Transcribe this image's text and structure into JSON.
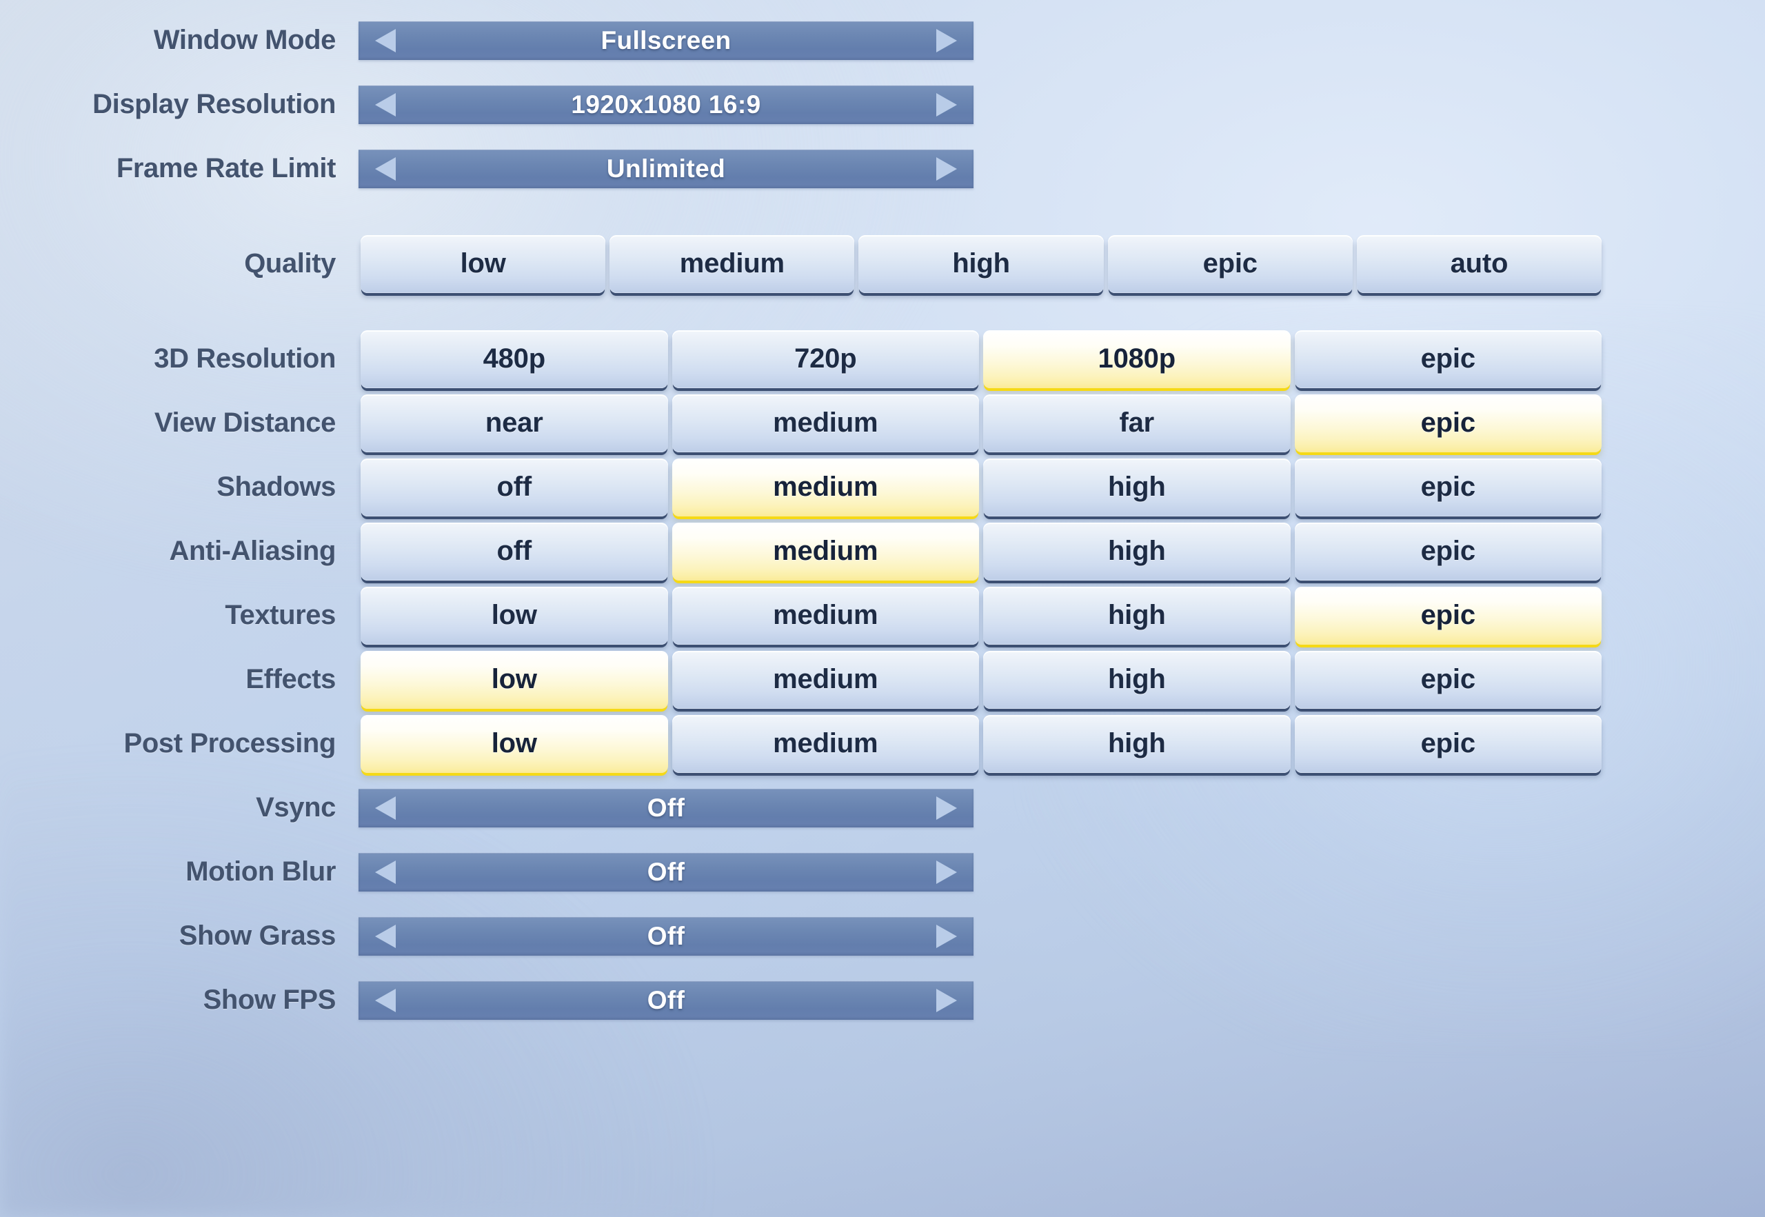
{
  "theme": {
    "bg_top_left": "#d9e0e9",
    "bg_bottom_left": "#a6b6d6",
    "bg_mid": "#bcd0ec",
    "label_color": "#43536e",
    "spinner_bar": "#6b86b2",
    "spinner_arrow": "#b9cce8",
    "spinner_value_text": "#ffffff",
    "button_off_top": "#f2f6fb",
    "button_off_bottom": "#bdcde7",
    "button_off_edge": "#3c4f72",
    "button_on_top": "#ffffff",
    "button_on_bottom": "#fbeb96",
    "button_on_edge": "#f5d916",
    "button_text": "#1d2b44"
  },
  "icons": {
    "prev": "triangle-left-icon",
    "next": "triangle-right-icon"
  },
  "settings": {
    "spinners_top": [
      {
        "label": "Window Mode",
        "value": "Fullscreen"
      },
      {
        "label": "Display Resolution",
        "value": "1920x1080 16:9"
      },
      {
        "label": "Frame Rate Limit",
        "value": "Unlimited"
      }
    ],
    "quality": {
      "label": "Quality",
      "options": [
        "low",
        "medium",
        "high",
        "epic",
        "auto"
      ],
      "selected": null
    },
    "groups": [
      {
        "label": "3D Resolution",
        "options": [
          "480p",
          "720p",
          "1080p",
          "epic"
        ],
        "selected": 2
      },
      {
        "label": "View Distance",
        "options": [
          "near",
          "medium",
          "far",
          "epic"
        ],
        "selected": 3
      },
      {
        "label": "Shadows",
        "options": [
          "off",
          "medium",
          "high",
          "epic"
        ],
        "selected": 1
      },
      {
        "label": "Anti-Aliasing",
        "options": [
          "off",
          "medium",
          "high",
          "epic"
        ],
        "selected": 1
      },
      {
        "label": "Textures",
        "options": [
          "low",
          "medium",
          "high",
          "epic"
        ],
        "selected": 3
      },
      {
        "label": "Effects",
        "options": [
          "low",
          "medium",
          "high",
          "epic"
        ],
        "selected": 0
      },
      {
        "label": "Post Processing",
        "options": [
          "low",
          "medium",
          "high",
          "epic"
        ],
        "selected": 0
      }
    ],
    "spinners_bottom": [
      {
        "label": "Vsync",
        "value": "Off"
      },
      {
        "label": "Motion Blur",
        "value": "Off"
      },
      {
        "label": "Show Grass",
        "value": "Off"
      },
      {
        "label": "Show FPS",
        "value": "Off"
      }
    ]
  }
}
